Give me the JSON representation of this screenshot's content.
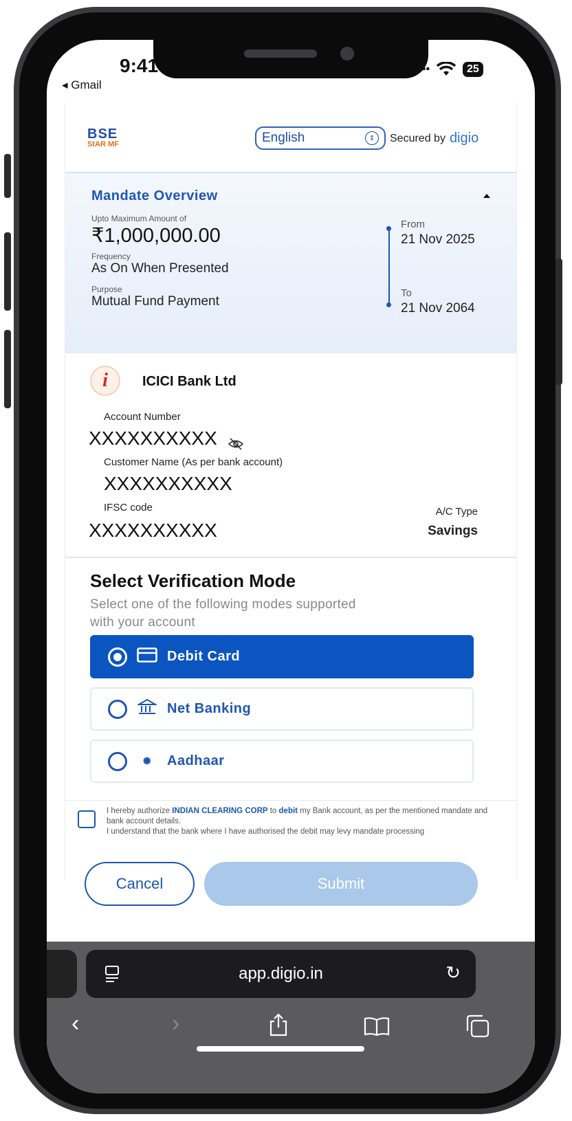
{
  "status_bar": {
    "time": "9:41",
    "back_app": "◂ Gmail",
    "battery": "25"
  },
  "header": {
    "logo_line1": "BSE",
    "logo_line2": "StAR MF",
    "language": "English",
    "secured_prefix": "Secured by",
    "secured_brand": "digio"
  },
  "overview": {
    "title": "Mandate Overview",
    "amount_label": "Upto Maximum Amount of",
    "amount": "₹1,000,000.00",
    "frequency_label": "Frequency",
    "frequency": "As On When Presented",
    "purpose_label": "Purpose",
    "purpose": "Mutual Fund Payment",
    "from_label": "From",
    "from_date": "21 Nov 2025",
    "to_label": "To",
    "to_date": "21 Nov 2064"
  },
  "bank": {
    "name": "ICICI Bank Ltd",
    "account_number_label": "Account Number",
    "account_number": "XXXXXXXXXX",
    "customer_name_label": "Customer Name (As per bank account)",
    "customer_name": "XXXXXXXXXX",
    "ifsc_label": "IFSC code",
    "ifsc": "XXXXXXXXXX",
    "ac_type_label": "A/C Type",
    "ac_type": "Savings"
  },
  "verification": {
    "title": "Select Verification Mode",
    "subtitle": "Select one of the following modes supported with your account",
    "modes": [
      {
        "label": "Debit Card",
        "icon": "card-icon",
        "selected": true
      },
      {
        "label": "Net Banking",
        "icon": "bank-icon",
        "selected": false
      },
      {
        "label": "Aadhaar",
        "icon": "aadhaar-icon",
        "selected": false
      }
    ]
  },
  "consent": {
    "part1": "I hereby authorize ",
    "org": "INDIAN CLEARING CORP",
    "part2": " to ",
    "debit": "debit",
    "part3": " my Bank account, as per the mentioned mandate and bank account details.",
    "line2": "I understand that the bank where I have authorised the debit may levy mandate processing"
  },
  "actions": {
    "cancel": "Cancel",
    "submit": "Submit"
  },
  "browser": {
    "url": "app.digio.in"
  },
  "colors": {
    "primary": "#0a55c0",
    "submit_disabled": "#a9c8ea",
    "safari_bar": "#5b5b5d"
  }
}
